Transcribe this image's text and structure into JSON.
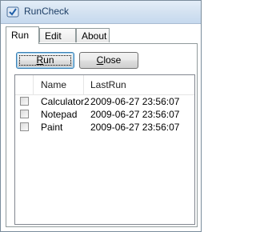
{
  "window": {
    "title": "RunCheck",
    "icon": "check-app-icon"
  },
  "tabs": [
    {
      "label": "Run",
      "active": true
    },
    {
      "label": "Edit",
      "active": false
    },
    {
      "label": "About",
      "active": false
    }
  ],
  "buttons": {
    "run_label": "Run",
    "run_mnemonic": "R",
    "close_label": "Close",
    "close_mnemonic": "C"
  },
  "list": {
    "columns": [
      "",
      "Name",
      "LastRun"
    ],
    "rows": [
      {
        "checked": false,
        "name": "Calculator2",
        "last_run": "2009-06-27 23:56:07"
      },
      {
        "checked": false,
        "name": "Notepad",
        "last_run": "2009-06-27 23:56:07"
      },
      {
        "checked": false,
        "name": "Paint",
        "last_run": "2009-06-27 23:56:07"
      }
    ]
  },
  "colors": {
    "title_text": "#1e3f66",
    "focus_border": "#3c7fb1"
  }
}
